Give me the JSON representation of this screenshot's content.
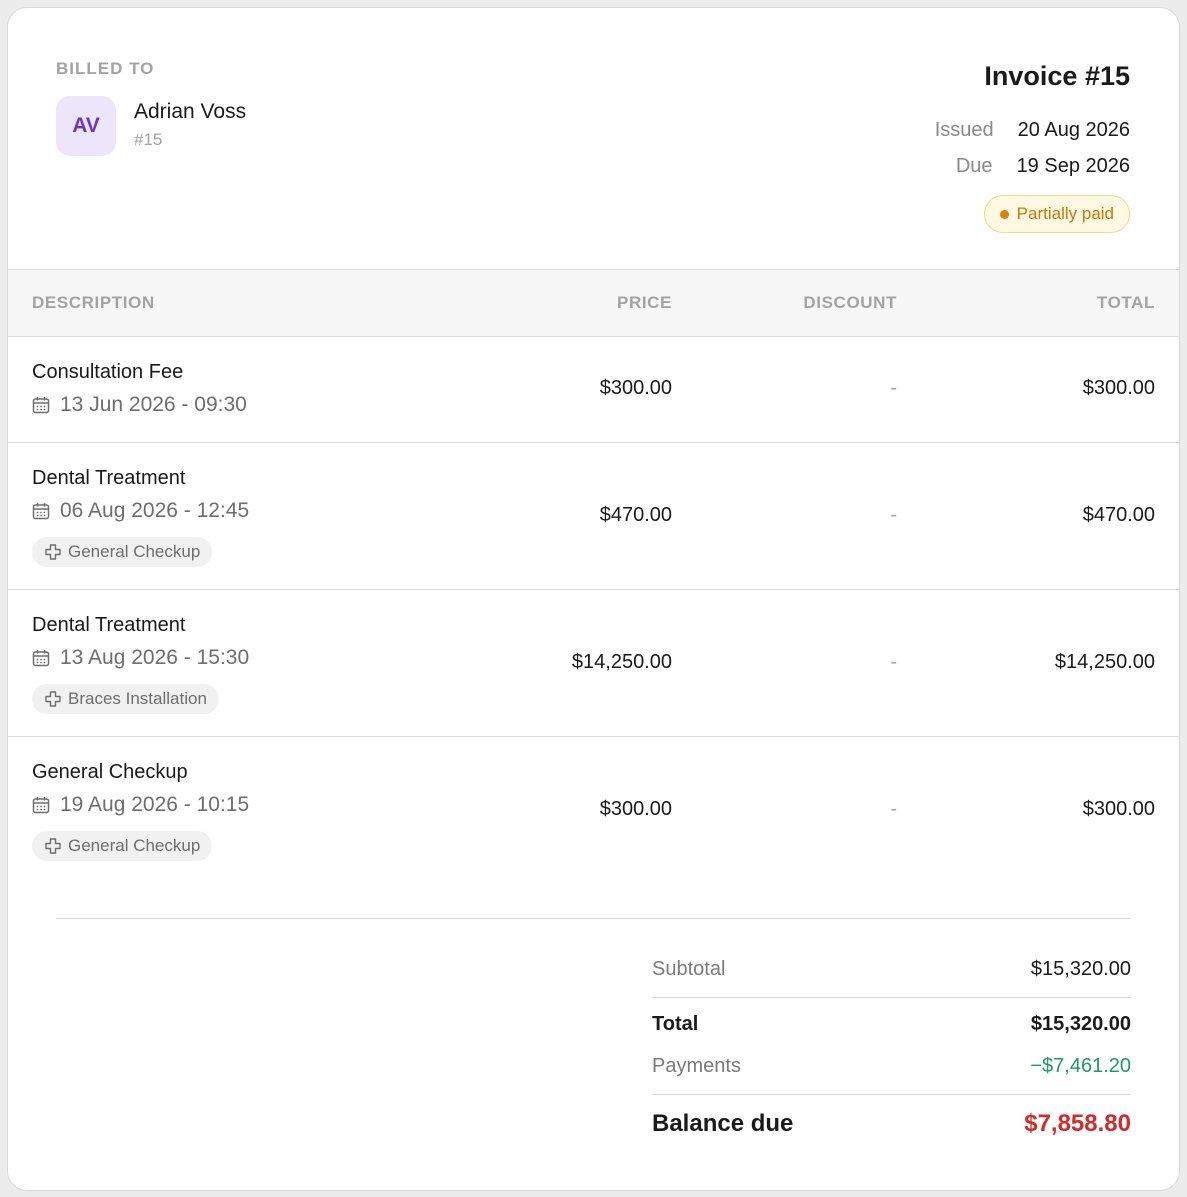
{
  "billed_to": {
    "label": "BILLED TO",
    "initials": "AV",
    "name": "Adrian Voss",
    "id": "#15"
  },
  "invoice": {
    "title": "Invoice #15",
    "issued_label": "Issued",
    "issued": "20 Aug 2026",
    "due_label": "Due",
    "due": "19 Sep 2026",
    "status": "Partially paid"
  },
  "table": {
    "headers": {
      "description": "DESCRIPTION",
      "price": "PRICE",
      "discount": "DISCOUNT",
      "total": "TOTAL"
    },
    "rows": [
      {
        "name": "Consultation Fee",
        "date": "13 Jun 2026 - 09:30",
        "tag": "",
        "price": "$300.00",
        "discount": "-",
        "total": "$300.00"
      },
      {
        "name": "Dental Treatment",
        "date": "06 Aug 2026 - 12:45",
        "tag": "General Checkup",
        "price": "$470.00",
        "discount": "-",
        "total": "$470.00"
      },
      {
        "name": "Dental Treatment",
        "date": "13 Aug 2026 - 15:30",
        "tag": "Braces Installation",
        "price": "$14,250.00",
        "discount": "-",
        "total": "$14,250.00"
      },
      {
        "name": "General Checkup",
        "date": "19 Aug 2026 - 10:15",
        "tag": "General Checkup",
        "price": "$300.00",
        "discount": "-",
        "total": "$300.00"
      }
    ]
  },
  "summary": {
    "subtotal_label": "Subtotal",
    "subtotal": "$15,320.00",
    "total_label": "Total",
    "total": "$15,320.00",
    "payments_label": "Payments",
    "payments": "−$7,461.20",
    "balance_label": "Balance due",
    "balance": "$7,858.80"
  },
  "colors": {
    "status": "#c77a06",
    "payments": "#1c9a6b",
    "balance": "#d12b2b",
    "avatar": "#6a38c9"
  }
}
